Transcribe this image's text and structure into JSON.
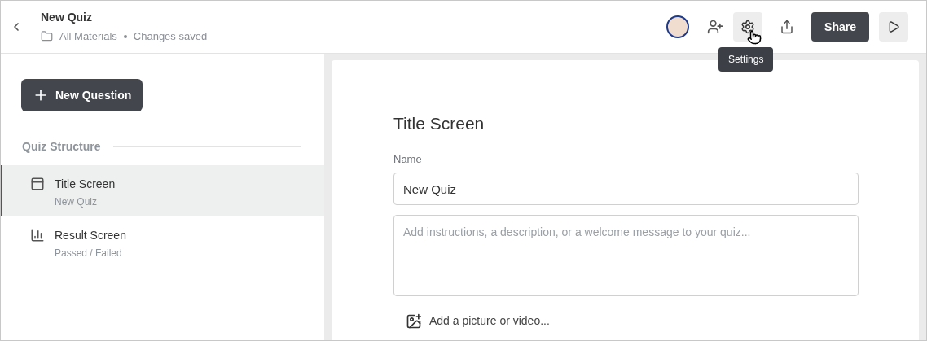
{
  "header": {
    "title": "New Quiz",
    "folder": "All Materials",
    "status": "Changes saved"
  },
  "toolbar": {
    "tooltip": "Settings",
    "share": "Share"
  },
  "sidebar": {
    "new_button": "New Question",
    "section_title": "Quiz Structure",
    "items": [
      {
        "kind": "title",
        "label": "Title Screen",
        "sublabel": "New Quiz",
        "selected": true
      },
      {
        "kind": "result",
        "label": "Result Screen",
        "sublabel": "Passed / Failed",
        "selected": false
      }
    ]
  },
  "editor": {
    "heading": "Title Screen",
    "name_label": "Name",
    "name_value": "New Quiz",
    "description_placeholder": "Add instructions, a description, or a welcome message to your quiz...",
    "media_link": "Add a picture or video..."
  }
}
